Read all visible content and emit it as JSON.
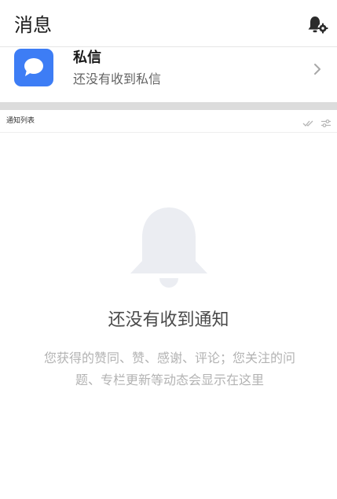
{
  "header": {
    "title": "消息",
    "settings_icon": "bell-settings-icon"
  },
  "private_message": {
    "title": "私信",
    "subtitle": "还没有收到私信",
    "icon": "chat-bubble-icon",
    "accent_color": "#3d7df5"
  },
  "notification_list": {
    "label": "通知列表",
    "actions": [
      "mark-all-read-icon",
      "filter-settings-icon"
    ]
  },
  "empty_state": {
    "icon": "bell-icon",
    "title": "还没有收到通知",
    "description": "您获得的赞同、赞、感谢、评论；您关注的问题、专栏更新等动态会显示在这里"
  }
}
